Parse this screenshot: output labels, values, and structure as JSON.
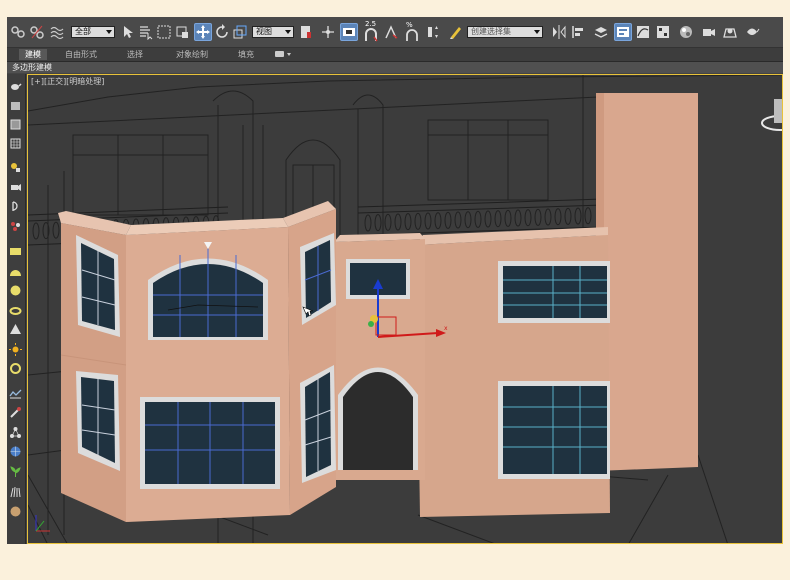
{
  "toolbar": {
    "selection_filter": "全部",
    "view_dropdown": "视图",
    "snap_angle_label": "2.5",
    "percent_label": "%",
    "named_selection_placeholder": "创建选择集"
  },
  "ribbon": {
    "tabs": [
      "建模",
      "自由形式",
      "选择",
      "对象绘制",
      "填充"
    ]
  },
  "subbar": {
    "label": "多边形建模"
  },
  "viewport": {
    "label": "[+][正交][明暗处理]"
  },
  "colors": {
    "accent": "#5b84b8",
    "wall": "#d8a990",
    "glass": "#1f3240",
    "frame": "#dedede"
  }
}
